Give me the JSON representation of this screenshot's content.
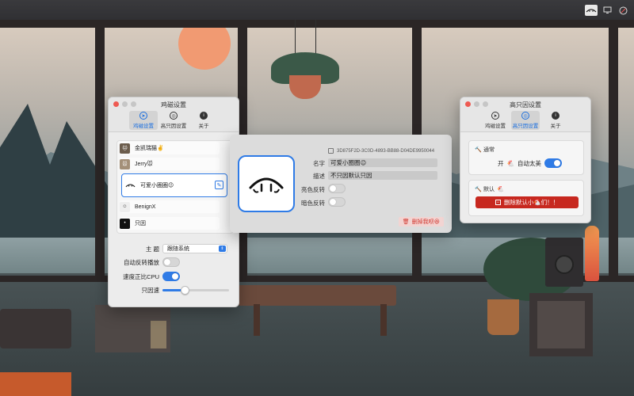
{
  "menubar": {
    "icons": [
      "face-icon",
      "monitor-icon",
      "swirl-icon"
    ]
  },
  "main_window": {
    "title": "鸡磁设置",
    "tabs": [
      {
        "label": "鸡磁设置",
        "icon": "compass-icon",
        "selected": true
      },
      {
        "label": "高只因设置",
        "icon": "target-icon",
        "selected": false
      },
      {
        "label": "关于",
        "icon": "info-icon",
        "selected": false
      }
    ],
    "characters": [
      {
        "name": "金凯瑞猫✌️"
      },
      {
        "name": "Jerry🐭"
      },
      {
        "name": "可爱小圈圈😉",
        "selected": true
      },
      {
        "name": "BenignX"
      },
      {
        "name": "只因"
      }
    ],
    "theme_label": "主   题",
    "theme_value": "跟随系统",
    "auto_reverse_label": "自动反转播放",
    "auto_reverse_on": false,
    "speed_cpu_label": "速度正比CPU",
    "speed_cpu_on": true,
    "speed_label": "只因速",
    "speed_value": 0.33
  },
  "popover": {
    "uuid": "3D875F2D-3C0D-4893-BB88-D04DE9950044",
    "name_label": "名字",
    "name_value": "可爱小圈圈😉",
    "desc_label": "描述",
    "desc_value": "不只因默认只因",
    "light_invert_label": "亮色反转",
    "light_invert_on": false,
    "dark_invert_label": "暗色反转",
    "dark_invert_on": false,
    "delete_label": "删掉我呗😆"
  },
  "adv_window": {
    "title": "高只因设置",
    "tabs": [
      {
        "label": "鸡磁设置",
        "icon": "compass-icon",
        "selected": false
      },
      {
        "label": "高只因设置",
        "icon": "target-icon",
        "selected": true
      },
      {
        "label": "关于",
        "icon": "info-icon",
        "selected": false
      }
    ],
    "general_title": "通常",
    "auto_run_prefix": "开",
    "auto_run_label": "自动太美",
    "auto_run_on": true,
    "default_title": "默认",
    "delete_default_label": "删除默认小🐔们！！"
  },
  "colors": {
    "accent": "#2f7be6",
    "danger": "#c7281f"
  }
}
